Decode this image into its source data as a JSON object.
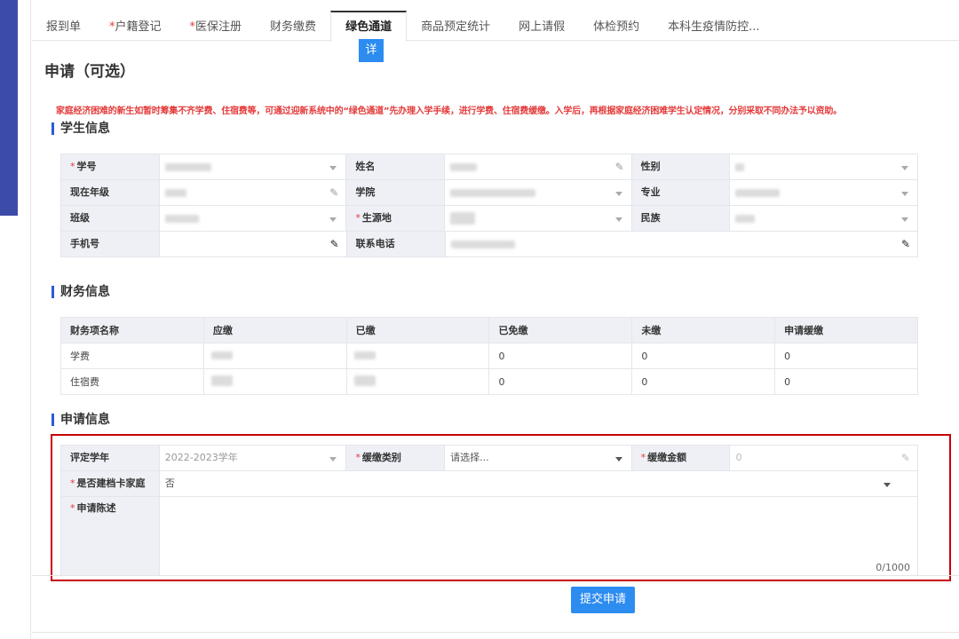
{
  "tabs": [
    {
      "label": "报到单",
      "required": false
    },
    {
      "label": "户籍登记",
      "required": true
    },
    {
      "label": "医保注册",
      "required": true
    },
    {
      "label": "财务缴费",
      "required": false
    },
    {
      "label": "绿色通道",
      "required": false,
      "active": true
    },
    {
      "label": "商品预定统计",
      "required": false
    },
    {
      "label": "网上请假",
      "required": false
    },
    {
      "label": "体检预约",
      "required": false
    },
    {
      "label": "本科生疫情防控...",
      "required": false
    }
  ],
  "detail_badge": "详",
  "page_title": "申请（可选）",
  "notice": "家庭经济困难的新生如暂时筹集不齐学费、住宿费等，可通过迎新系统中的“绿色通道”先办理入学手续，进行学费、住宿费缓缴。入学后，再根据家庭经济困难学生认定情况，分别采取不同办法予以资助。",
  "student_section": {
    "title": "学生信息",
    "fields": {
      "student_id": "学号",
      "name": "姓名",
      "gender": "性别",
      "grade": "现在年级",
      "college": "学院",
      "major": "专业",
      "class": "班级",
      "origin": "生源地",
      "ethnicity": "民族",
      "mobile": "手机号",
      "contact_phone": "联系电话"
    }
  },
  "finance_section": {
    "title": "财务信息",
    "headers": [
      "财务项名称",
      "应缴",
      "已缴",
      "已免缴",
      "未缴",
      "申请缓缴"
    ],
    "rows": [
      {
        "item": "学费",
        "exempt": "0",
        "unpaid": "0",
        "defer": "0"
      },
      {
        "item": "住宿费",
        "exempt": "0",
        "unpaid": "0",
        "defer": "0"
      }
    ]
  },
  "application_section": {
    "title": "申请信息",
    "year_label": "评定学年",
    "year_value": "2022-2023学年",
    "defer_type_label": "缓缴类别",
    "defer_type_placeholder": "请选择...",
    "defer_amount_label": "缓缴金额",
    "defer_amount_value": "0",
    "file_card_label": "是否建档卡家庭",
    "file_card_value": "否",
    "statement_label": "申请陈述",
    "statement_counter": "0/1000"
  },
  "submit_label": "提交申请",
  "colors": {
    "accent": "#2d8cf0",
    "required": "#e43a3a",
    "highlight_outline": "#c8000a",
    "sidebar": "#3d4ba8"
  }
}
